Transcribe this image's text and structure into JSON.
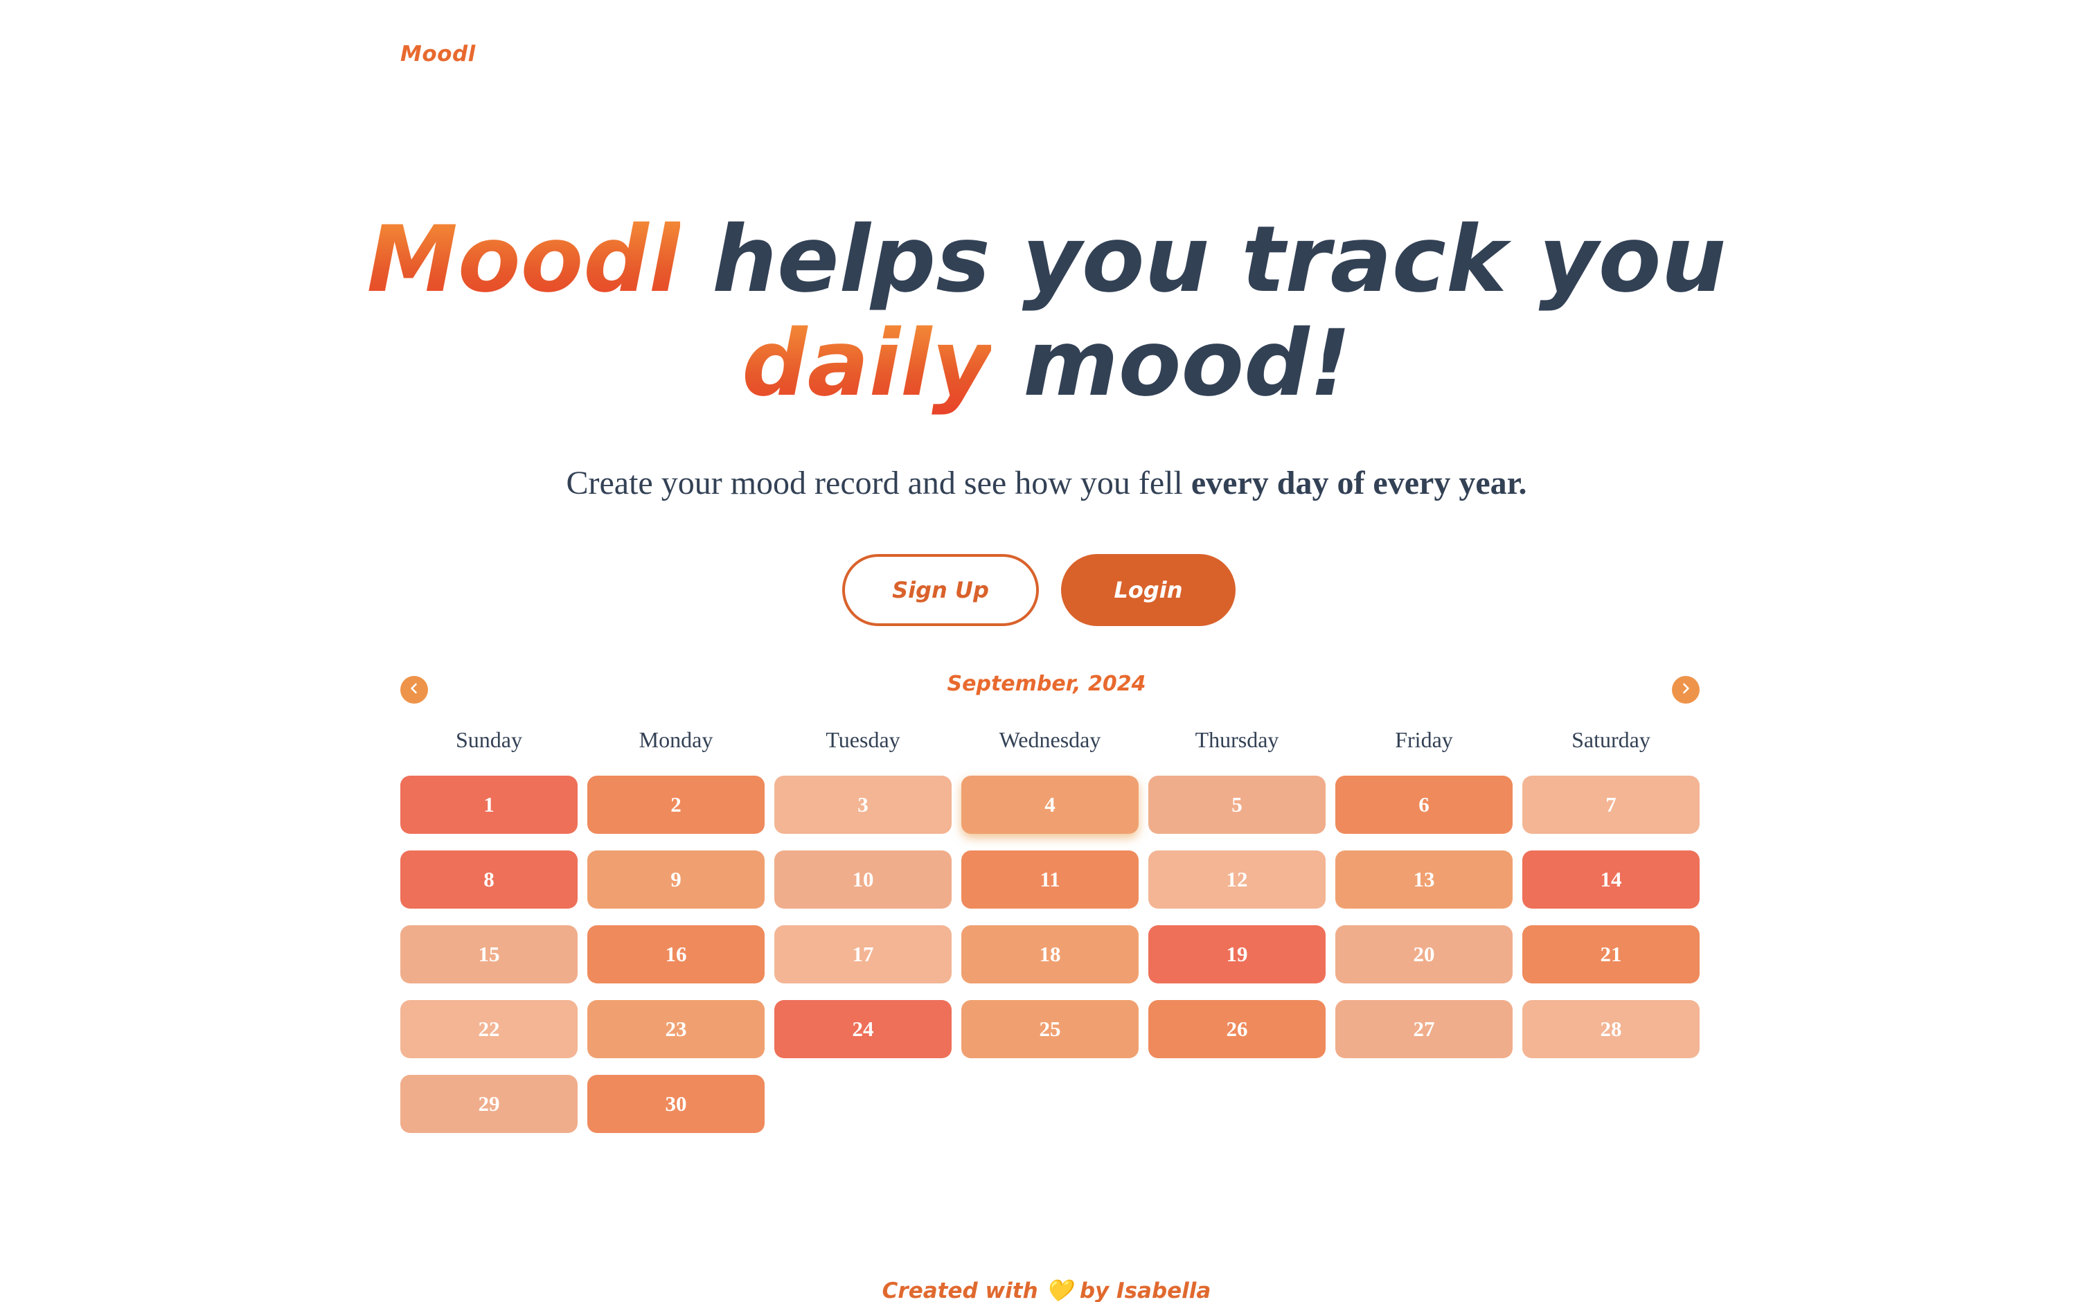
{
  "header": {
    "logo": "Moodl"
  },
  "hero": {
    "brand": "Moodl",
    "line1_rest": "helps you track you",
    "highlight": "daily",
    "line2_rest": "mood!"
  },
  "subtitle": {
    "text": "Create your mood record and see how you fell ",
    "emphasis": "every day of every year."
  },
  "buttons": {
    "signup": "Sign Up",
    "login": "Login"
  },
  "calendar": {
    "month_label": "September, 2024",
    "prev_icon": "chevron-left-icon",
    "next_icon": "chevron-right-icon",
    "weekdays": [
      "Sunday",
      "Monday",
      "Tuesday",
      "Wednesday",
      "Thursday",
      "Friday",
      "Saturday"
    ],
    "start_weekday": 0,
    "today": 4,
    "mood_colors": [
      "#f3b594",
      "#f0ad8b",
      "#f0a070",
      "#ef8a5c",
      "#ee7059"
    ],
    "days": [
      {
        "day": 1,
        "mood": 4
      },
      {
        "day": 2,
        "mood": 3
      },
      {
        "day": 3,
        "mood": 0
      },
      {
        "day": 4,
        "mood": 2
      },
      {
        "day": 5,
        "mood": 1
      },
      {
        "day": 6,
        "mood": 3
      },
      {
        "day": 7,
        "mood": 0
      },
      {
        "day": 8,
        "mood": 4
      },
      {
        "day": 9,
        "mood": 2
      },
      {
        "day": 10,
        "mood": 1
      },
      {
        "day": 11,
        "mood": 3
      },
      {
        "day": 12,
        "mood": 0
      },
      {
        "day": 13,
        "mood": 2
      },
      {
        "day": 14,
        "mood": 4
      },
      {
        "day": 15,
        "mood": 1
      },
      {
        "day": 16,
        "mood": 3
      },
      {
        "day": 17,
        "mood": 0
      },
      {
        "day": 18,
        "mood": 2
      },
      {
        "day": 19,
        "mood": 4
      },
      {
        "day": 20,
        "mood": 1
      },
      {
        "day": 21,
        "mood": 3
      },
      {
        "day": 22,
        "mood": 0
      },
      {
        "day": 23,
        "mood": 2
      },
      {
        "day": 24,
        "mood": 4
      },
      {
        "day": 25,
        "mood": 2
      },
      {
        "day": 26,
        "mood": 3
      },
      {
        "day": 27,
        "mood": 1
      },
      {
        "day": 28,
        "mood": 0
      },
      {
        "day": 29,
        "mood": 1
      },
      {
        "day": 30,
        "mood": 3
      }
    ]
  },
  "footer": {
    "prefix": "Created with",
    "heart": "💛",
    "suffix": "by Isabella"
  }
}
